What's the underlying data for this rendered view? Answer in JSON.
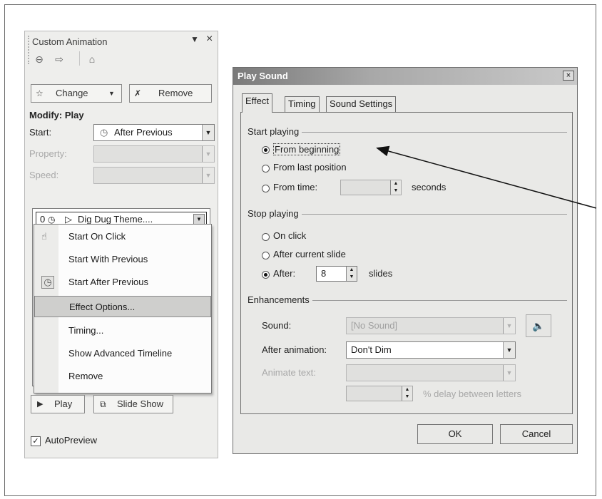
{
  "pane": {
    "title": "Custom Animation",
    "change_label": "Change",
    "remove_label": "Remove",
    "modify_heading": "Modify: Play",
    "start_label": "Start:",
    "start_value": "After Previous",
    "property_label": "Property:",
    "speed_label": "Speed:",
    "list_item": {
      "number": "0",
      "name": "Dig Dug Theme...."
    },
    "menu": [
      {
        "label": "Start On Click"
      },
      {
        "label": "Start With Previous"
      },
      {
        "label": "Start After Previous"
      },
      {
        "label": "Effect Options..."
      },
      {
        "label": "Timing..."
      },
      {
        "label": "Show Advanced Timeline"
      },
      {
        "label": "Remove"
      }
    ],
    "play_label": "Play",
    "slideshow_label": "Slide Show",
    "autopreview_label": "AutoPreview",
    "autopreview_checked": true
  },
  "dialog": {
    "title": "Play Sound",
    "tabs": [
      "Effect",
      "Timing",
      "Sound Settings"
    ],
    "start_group": "Start playing",
    "start_options": [
      "From beginning",
      "From last position",
      "From time:"
    ],
    "seconds_label": "seconds",
    "stop_group": "Stop playing",
    "stop_options": [
      "On click",
      "After current slide",
      "After:"
    ],
    "after_value": "8",
    "slides_label": "slides",
    "enh_group": "Enhancements",
    "sound_label": "Sound:",
    "sound_value": "[No Sound]",
    "after_anim_label": "After animation:",
    "after_anim_value": "Don't Dim",
    "animate_text_label": "Animate text:",
    "delay_label": "% delay between letters",
    "ok_label": "OK",
    "cancel_label": "Cancel"
  }
}
